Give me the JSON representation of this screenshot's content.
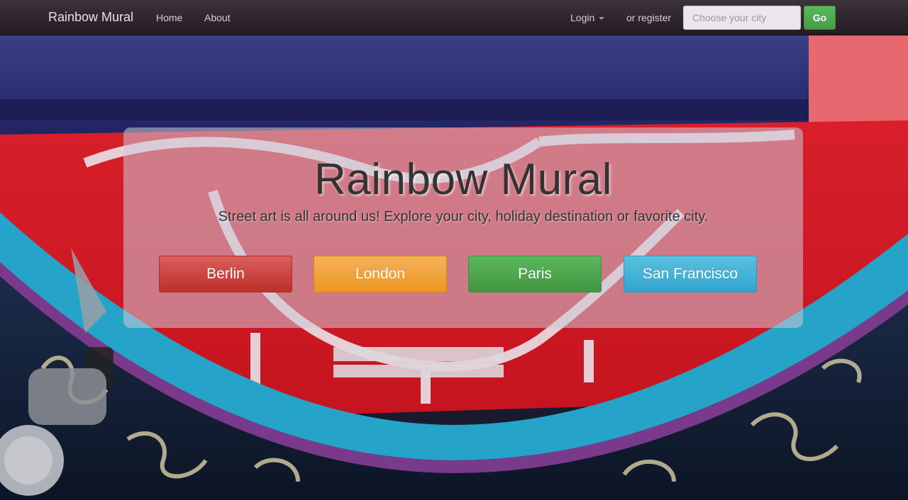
{
  "navbar": {
    "brand": "Rainbow Mural",
    "home": "Home",
    "about": "About",
    "login": "Login",
    "register": "or register",
    "search_placeholder": "Choose your city",
    "go": "Go"
  },
  "hero": {
    "title": "Rainbow Mural",
    "subtitle": "Street art is all around us! Explore your city, holiday destination or favorite city.",
    "cities": [
      "Berlin",
      "London",
      "Paris",
      "San Francisco"
    ]
  },
  "colors": {
    "navbar": "#2e262b",
    "berlin": "#d9534f",
    "london": "#f0ad4e",
    "paris": "#5cb85c",
    "san_francisco": "#5bc0de"
  }
}
